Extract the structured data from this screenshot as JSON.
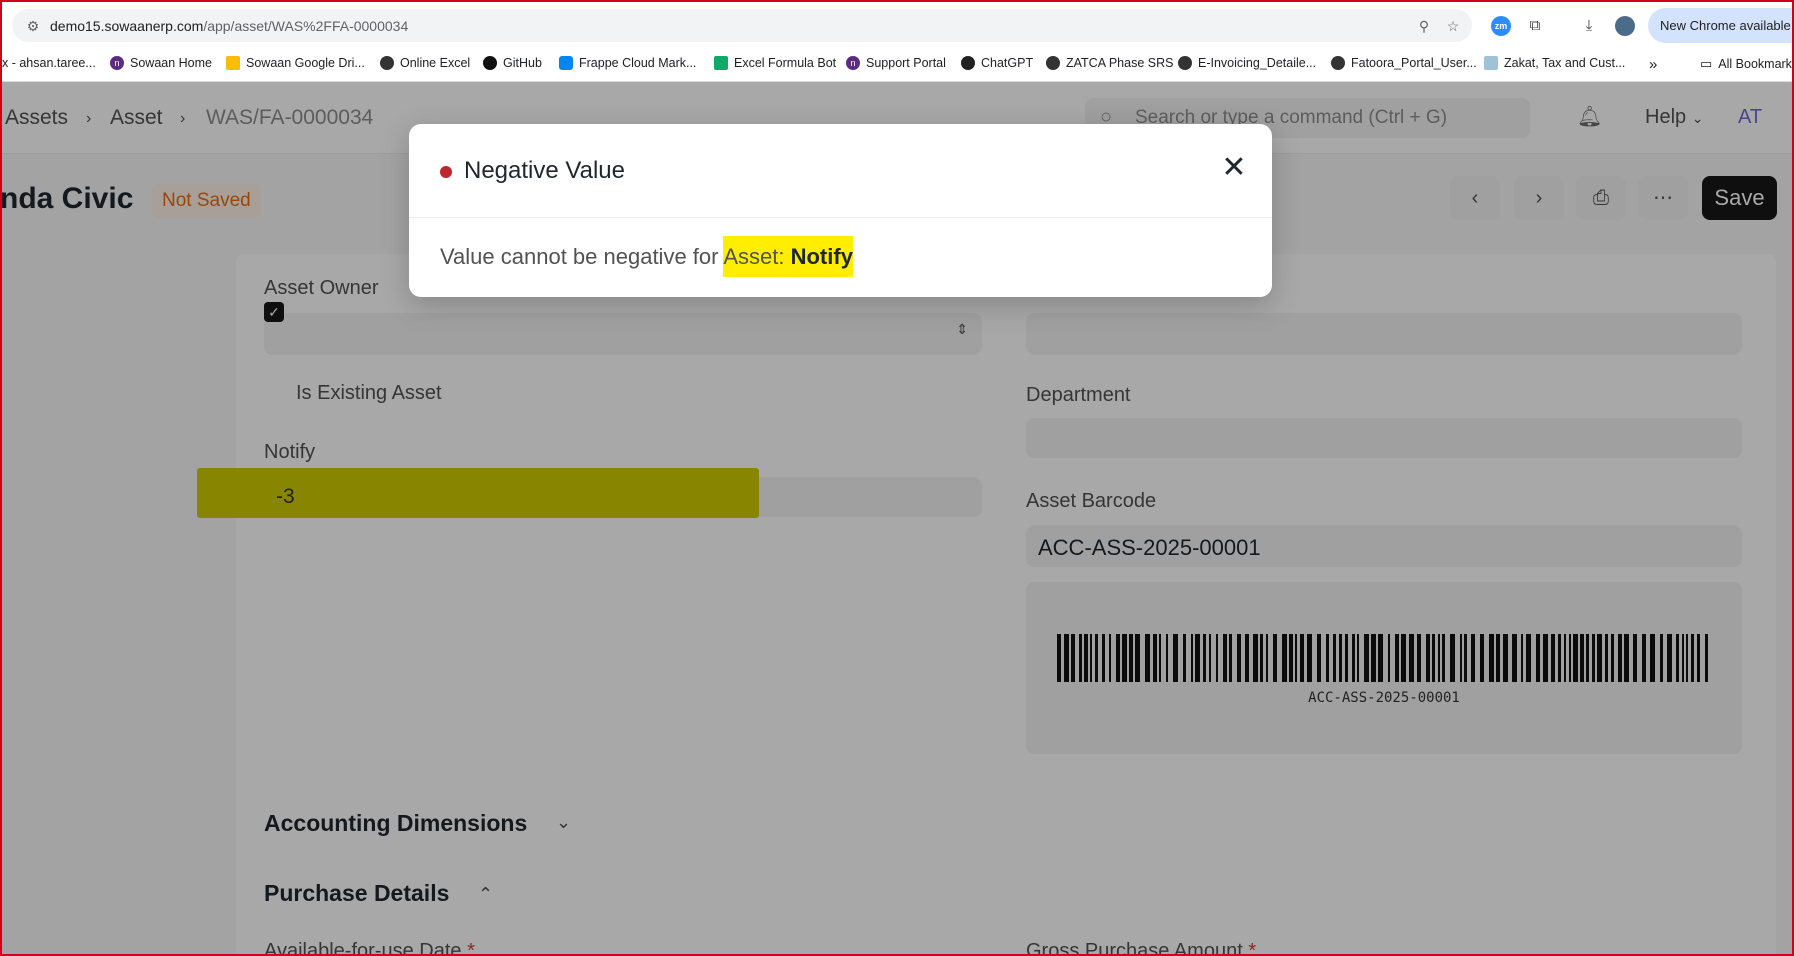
{
  "browser": {
    "url_host": "demo15.sowaanerp.com",
    "url_path": "/app/asset/WAS%2FFA-0000034",
    "new_chrome": "New Chrome available",
    "bookmarks": [
      {
        "label": "x - ahsan.taree...",
        "icon": "mail-icon"
      },
      {
        "label": "Sowaan Home",
        "icon": "sowaan-icon"
      },
      {
        "label": "Sowaan Google Dri...",
        "icon": "drive-icon"
      },
      {
        "label": "Online Excel",
        "icon": "globe-icon"
      },
      {
        "label": "GitHub",
        "icon": "github-icon"
      },
      {
        "label": "Frappe Cloud Mark...",
        "icon": "cloud-icon"
      },
      {
        "label": "Excel Formula Bot",
        "icon": "bot-icon"
      },
      {
        "label": "Support Portal",
        "icon": "sowaan-icon"
      },
      {
        "label": "ChatGPT",
        "icon": "chatgpt-icon"
      },
      {
        "label": "ZATCA Phase SRS",
        "icon": "globe-icon"
      },
      {
        "label": "E-Invoicing_Detaile...",
        "icon": "globe-icon"
      },
      {
        "label": "Fatoora_Portal_User...",
        "icon": "globe-icon"
      },
      {
        "label": "Zakat, Tax and Cust...",
        "icon": "zatca-icon"
      }
    ],
    "all_bookmarks": "All Bookmarks"
  },
  "navbar": {
    "breadcrumbs": [
      "Assets",
      "Asset",
      "WAS/FA-0000034"
    ],
    "search_placeholder": "Search or type a command (Ctrl + G)",
    "help": "Help",
    "avatar": "AT"
  },
  "page": {
    "title": "nda Civic",
    "status": "Not Saved",
    "save": "Save"
  },
  "form": {
    "asset_owner_label": "Asset Owner",
    "is_existing_asset_label": "Is Existing Asset",
    "notify_label": "Notify",
    "notify_value": "-3",
    "department_label": "Department",
    "asset_barcode_label": "Asset Barcode",
    "asset_barcode_value": "ACC-ASS-2025-00001",
    "barcode_text": "ACC-ASS-2025-00001",
    "section_accounting": "Accounting Dimensions",
    "section_purchase": "Purchase Details",
    "available_for_use_label": "Available-for-use Date",
    "gross_purchase_label": "Gross Purchase Amount"
  },
  "modal": {
    "title": "Negative Value",
    "message_prefix": "Value cannot be negative for ",
    "message_doctype": "Asset: ",
    "message_field": "Notify",
    "status_color": "#c0262d"
  }
}
